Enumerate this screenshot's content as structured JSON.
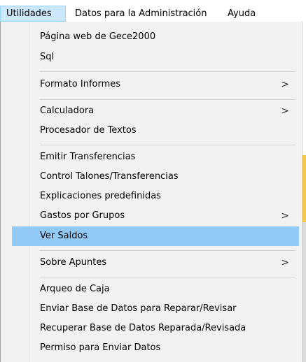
{
  "menubar": {
    "items": [
      "Utilidades",
      "Datos para la Administración",
      "Ayuda"
    ]
  },
  "dropdown": {
    "items": [
      {
        "label": "Página web de Gece2000",
        "submenu": false
      },
      {
        "label": "Sql",
        "submenu": false
      },
      {
        "label": "Formato Informes",
        "submenu": true
      },
      {
        "label": "Calculadora",
        "submenu": true
      },
      {
        "label": "Procesador de Textos",
        "submenu": false
      },
      {
        "label": "Emitir Transferencias",
        "submenu": false
      },
      {
        "label": "Control Talones/Transferencias",
        "submenu": false
      },
      {
        "label": "Explicaciones predefinidas",
        "submenu": false
      },
      {
        "label": "Gastos por Grupos",
        "submenu": true
      },
      {
        "label": "Ver Saldos",
        "submenu": false,
        "selected": true
      },
      {
        "label": "Sobre Apuntes",
        "submenu": true
      },
      {
        "label": "Arqueo de Caja",
        "submenu": false
      },
      {
        "label": "Enviar Base de Datos para Reparar/Revisar",
        "submenu": false
      },
      {
        "label": "Recuperar Base de Datos Reparada/Revisada",
        "submenu": false
      },
      {
        "label": "Permiso para Enviar Datos",
        "submenu": false
      }
    ],
    "submenu_arrow": ">"
  },
  "colors": {
    "menu_background": "#f2f2f2",
    "selected_background": "#91c9f7",
    "active_menubar_background": "#cce8ff"
  }
}
